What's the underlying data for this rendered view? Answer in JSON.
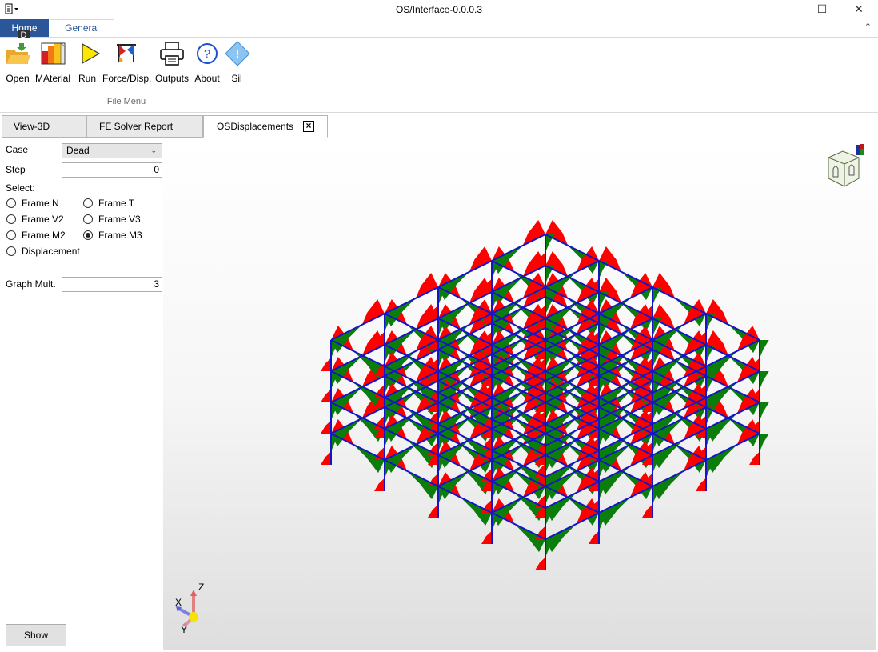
{
  "window": {
    "title": "OS/Interface-0.0.0.3",
    "minimize_glyph": "—",
    "maximize_glyph": "☐",
    "close_glyph": "✕"
  },
  "ribbon": {
    "tabs": [
      {
        "label": "Home",
        "keytip": "D"
      },
      {
        "label": "General"
      }
    ],
    "collapse_glyph": "⌃",
    "buttons": [
      {
        "label": "Open",
        "icon": "folder-open-icon"
      },
      {
        "label": "MAterial",
        "icon": "material-chart-icon"
      },
      {
        "label": "Run",
        "icon": "play-icon"
      },
      {
        "label": "Force/Disp.",
        "icon": "force-disp-icon"
      },
      {
        "label": "Outputs",
        "icon": "printer-icon"
      },
      {
        "label": "About",
        "icon": "help-icon"
      },
      {
        "label": "Sil",
        "icon": "info-diamond-icon"
      }
    ],
    "group_label": "File Menu"
  },
  "doc_tabs": [
    {
      "label": "View-3D"
    },
    {
      "label": "FE Solver Report"
    },
    {
      "label": "OSDisplacements",
      "active": true
    }
  ],
  "panel": {
    "case_label": "Case",
    "case_value": "Dead",
    "step_label": "Step",
    "step_value": "0",
    "select_label": "Select:",
    "options": [
      {
        "label": "Frame N",
        "checked": false
      },
      {
        "label": "Frame T",
        "checked": false
      },
      {
        "label": "Frame V2",
        "checked": false
      },
      {
        "label": "Frame V3",
        "checked": false
      },
      {
        "label": "Frame M2",
        "checked": false
      },
      {
        "label": "Frame M3",
        "checked": true
      },
      {
        "label": "Displacement",
        "checked": false
      }
    ],
    "graph_mult_label": "Graph Mult.",
    "graph_mult_value": "3",
    "show_button": "Show"
  },
  "viewport": {
    "axis_labels": {
      "z": "Z",
      "x": "X",
      "y": "Y"
    },
    "colors": {
      "frame": "#1414c8",
      "positive": "#ff0000",
      "negative": "#0a7d0a",
      "accent": "#2b579a"
    }
  }
}
